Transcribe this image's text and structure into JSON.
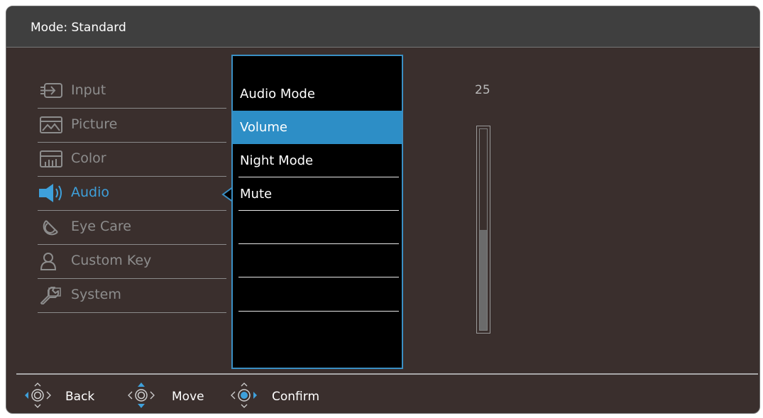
{
  "header": {
    "mode_text": "Mode: Standard"
  },
  "nav": {
    "items": [
      {
        "label": "Input",
        "icon": "input-icon"
      },
      {
        "label": "Picture",
        "icon": "picture-icon"
      },
      {
        "label": "Color",
        "icon": "color-icon"
      },
      {
        "label": "Audio",
        "icon": "speaker-icon",
        "active": true
      },
      {
        "label": "Eye Care",
        "icon": "eye-care-icon"
      },
      {
        "label": "Custom Key",
        "icon": "person-icon"
      },
      {
        "label": "System",
        "icon": "wrench-icon"
      }
    ]
  },
  "submenu": {
    "options": [
      "Audio Mode",
      "Volume",
      "Night Mode",
      "Mute"
    ],
    "selected": "Volume"
  },
  "volume": {
    "value": "25",
    "level_fraction": 0.5
  },
  "footer": {
    "back_label": "Back",
    "move_label": "Move",
    "confirm_label": "Confirm"
  },
  "colors": {
    "accent": "#3ea0db",
    "selected_bg": "#2d8ec6",
    "panel_border": "#3a8fc4",
    "background": "#3a2f2d"
  }
}
